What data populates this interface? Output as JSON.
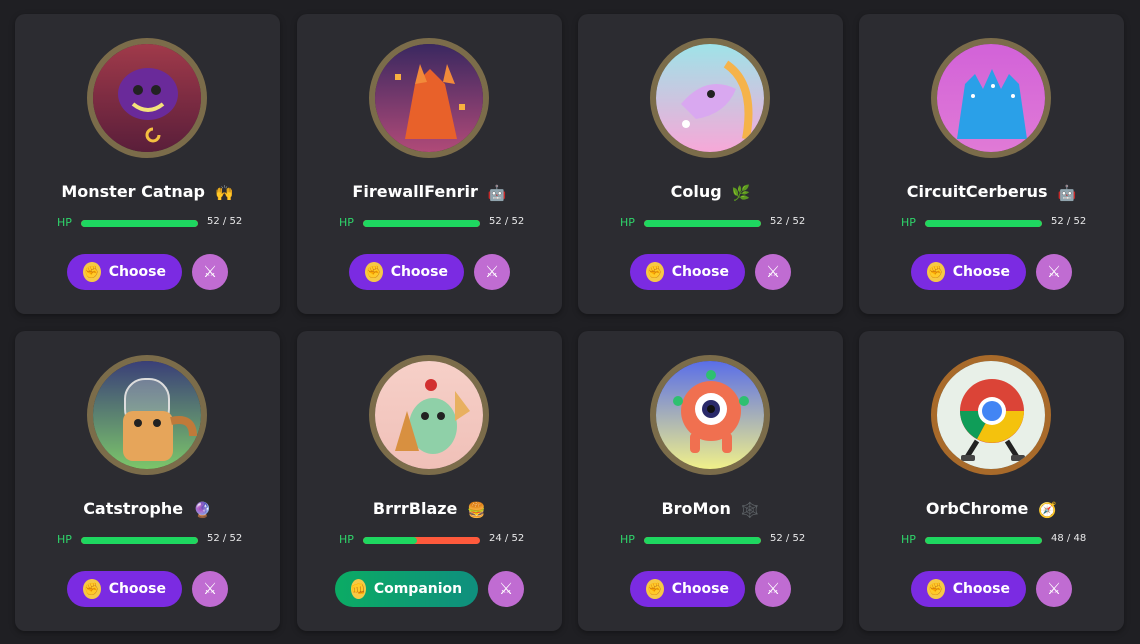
{
  "cards": [
    {
      "name": "Monster Catnap",
      "badge": "🙌",
      "hp_label": "HP",
      "hp_text": "52 / 52",
      "hp_fraction": 1.0,
      "button_label": "Choose",
      "button_style": "purple",
      "ring_color": "#7b6c4a",
      "bg": [
        "#a03a4a",
        "#5a1e3a"
      ]
    },
    {
      "name": "FirewallFenrir",
      "badge": "🤖",
      "hp_label": "HP",
      "hp_text": "52 / 52",
      "hp_fraction": 1.0,
      "button_label": "Choose",
      "button_style": "purple",
      "ring_color": "#7b6c4a",
      "bg": [
        "#3a2860",
        "#b04a78"
      ]
    },
    {
      "name": "Colug",
      "badge": "🌿",
      "hp_label": "HP",
      "hp_text": "52 / 52",
      "hp_fraction": 1.0,
      "button_label": "Choose",
      "button_style": "purple",
      "ring_color": "#7b6c4a",
      "bg": [
        "#9fe3e8",
        "#f7a8d8"
      ]
    },
    {
      "name": "CircuitCerberus",
      "badge": "🤖",
      "hp_label": "HP",
      "hp_text": "52 / 52",
      "hp_fraction": 1.0,
      "button_label": "Choose",
      "button_style": "purple",
      "ring_color": "#7b6c4a",
      "bg": [
        "#d262d8",
        "#e07ad6"
      ]
    },
    {
      "name": "Catstrophe",
      "badge": "🔮",
      "hp_label": "HP",
      "hp_text": "52 / 52",
      "hp_fraction": 1.0,
      "button_label": "Choose",
      "button_style": "purple",
      "ring_color": "#7b6c4a",
      "bg": [
        "#3a3f78",
        "#7cc66a"
      ]
    },
    {
      "name": "BrrrBlaze",
      "badge": "🍔",
      "hp_label": "HP",
      "hp_text": "24 / 52",
      "hp_fraction": 0.46,
      "button_label": "Companion",
      "button_style": "green",
      "ring_color": "#7b6c4a",
      "bg": [
        "#f6d0c8",
        "#f0c0b8"
      ]
    },
    {
      "name": "BroMon",
      "badge": "🕸️",
      "hp_label": "HP",
      "hp_text": "52 / 52",
      "hp_fraction": 1.0,
      "button_label": "Choose",
      "button_style": "purple",
      "ring_color": "#7b6c4a",
      "bg": [
        "#5a6ee8",
        "#f0f08a"
      ]
    },
    {
      "name": "OrbChrome",
      "badge": "🧭",
      "hp_label": "HP",
      "hp_text": "48 / 48",
      "hp_fraction": 1.0,
      "button_label": "Choose",
      "button_style": "purple",
      "ring_color": "#a86a2a",
      "bg": [
        "#e8f0e8",
        "#e8f0e8"
      ]
    }
  ],
  "icons": {
    "choose": "raised-fist-icon",
    "companion": "fist-icon",
    "battle": "crossed-swords-icon"
  }
}
